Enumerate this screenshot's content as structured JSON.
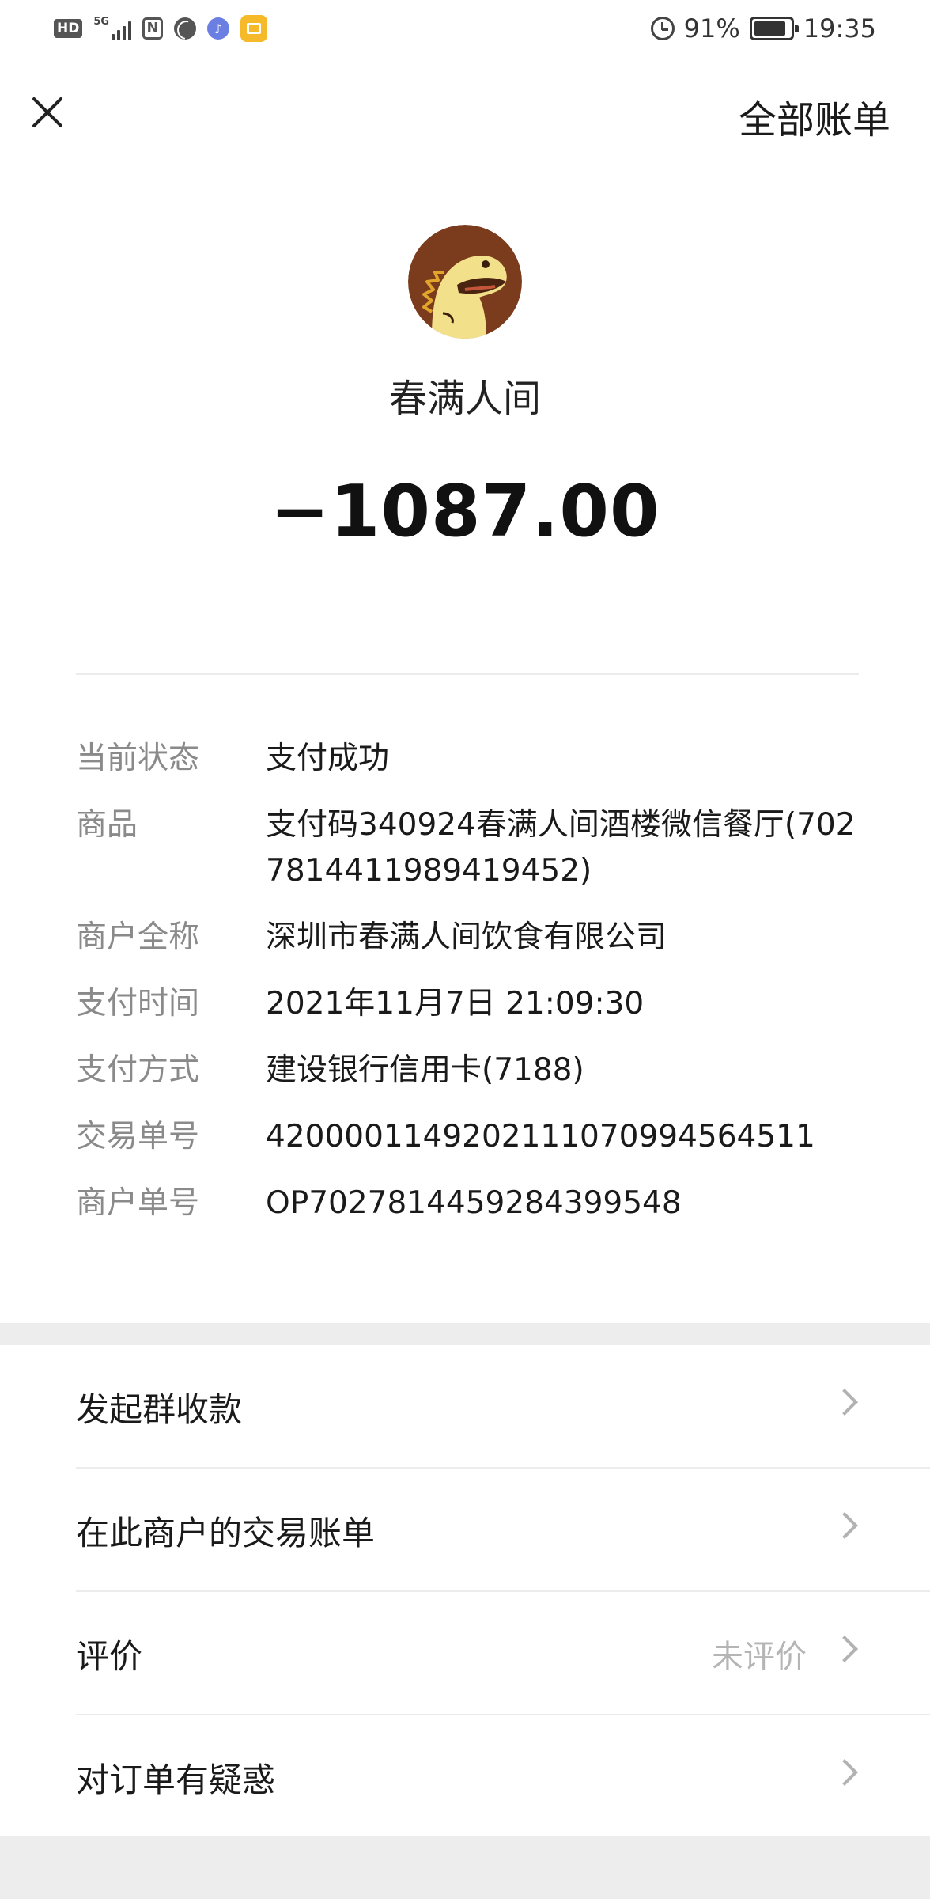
{
  "status_bar": {
    "left_icons": [
      "hd-icon",
      "5g-signal-icon",
      "nfc-icon",
      "ball-icon",
      "music-icon",
      "app-icon"
    ],
    "hd_label": "HD",
    "network_label": "5G",
    "nfc_label": "N",
    "battery_percent": "91%",
    "time": "19:35"
  },
  "header": {
    "all_bills_label": "全部账单"
  },
  "merchant": {
    "name": "春满人间",
    "amount": "−1087.00"
  },
  "details": {
    "status_label": "当前状态",
    "status_value": "支付成功",
    "product_label": "商品",
    "product_value": "支付码340924春满人间酒楼微信餐厅(7027814411989419452)",
    "merchant_full_label": "商户全称",
    "merchant_full_value": "深圳市春满人间饮食有限公司",
    "pay_time_label": "支付时间",
    "pay_time_value": "2021年11月7日 21:09:30",
    "pay_method_label": "支付方式",
    "pay_method_value": "建设银行信用卡(7188)",
    "transaction_no_label": "交易单号",
    "transaction_no_value": "4200001149202111070994564511",
    "merchant_no_label": "商户单号",
    "merchant_no_value": "OP7027814459284399548"
  },
  "menu": {
    "group_payment": "发起群收款",
    "merchant_bills": "在此商户的交易账单",
    "review": "评价",
    "review_status": "未评价",
    "order_question": "对订单有疑惑"
  },
  "colors": {
    "label_gray": "#8a8a8a",
    "text_dark": "#1a1a1a",
    "band_gray": "#ededed",
    "chevron_gray": "#b2b2b2"
  }
}
